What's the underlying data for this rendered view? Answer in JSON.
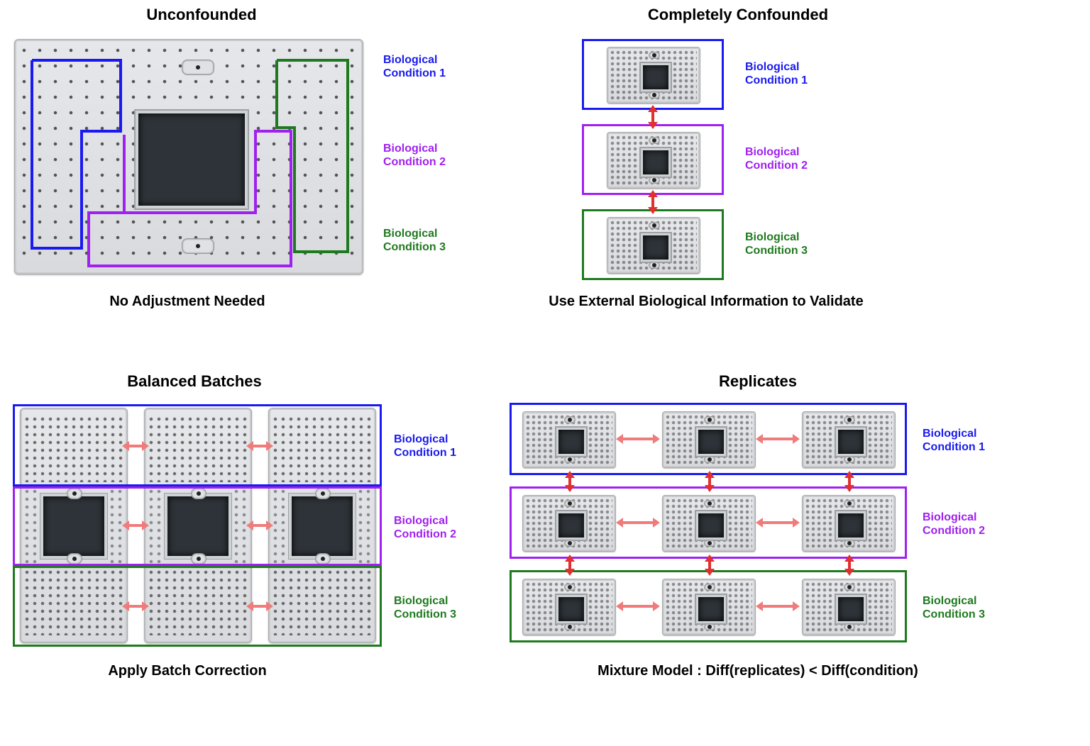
{
  "panels": {
    "unconfounded": {
      "title": "Unconfounded",
      "subtitle": "No Adjustment Needed"
    },
    "confounded": {
      "title": "Completely Confounded",
      "subtitle": "Use External Biological Information to Validate"
    },
    "balanced": {
      "title": "Balanced Batches",
      "subtitle": "Apply Batch Correction"
    },
    "replicates": {
      "title": "Replicates",
      "subtitle": "Mixture Model : Diff(replicates) < Diff(condition)"
    }
  },
  "conditions": {
    "c1": "Biological\nCondition 1",
    "c2": "Biological\nCondition 2",
    "c3": "Biological\nCondition 3"
  }
}
